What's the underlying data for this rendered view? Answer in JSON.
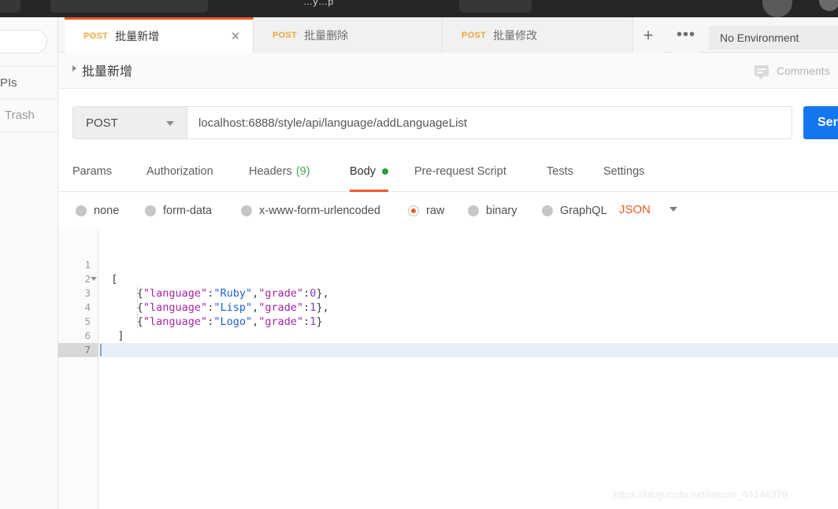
{
  "topbar": {
    "partial_text": "…y…p",
    "avatar_initials": ""
  },
  "sidebar": {
    "items": [
      {
        "label": "APIs",
        "name": "sidebar-item-apis"
      },
      {
        "label": "Trash",
        "name": "sidebar-item-trash"
      }
    ]
  },
  "request_tabs": {
    "items": [
      {
        "method": "POST",
        "title": "批量新增",
        "active": true,
        "closable": true
      },
      {
        "method": "POST",
        "title": "批量删除",
        "active": false,
        "closable": false
      },
      {
        "method": "POST",
        "title": "批量修改",
        "active": false,
        "closable": false
      }
    ],
    "new_tab_icon": "+",
    "more_icon": "•••"
  },
  "environment": {
    "selected": "No Environment"
  },
  "breadcrumb": {
    "title": "批量新增"
  },
  "comments": {
    "label": "Comments"
  },
  "request": {
    "method": "POST",
    "url": "localhost:6888/style/api/language/addLanguageList",
    "send_label": "Send"
  },
  "sub_tabs": [
    {
      "label": "Params",
      "active": false
    },
    {
      "label": "Authorization",
      "active": false
    },
    {
      "label": "Headers",
      "active": false,
      "count": "(9)"
    },
    {
      "label": "Body",
      "active": true,
      "dot": true
    },
    {
      "label": "Pre-request Script",
      "active": false
    },
    {
      "label": "Tests",
      "active": false
    },
    {
      "label": "Settings",
      "active": false
    }
  ],
  "body_types": {
    "options": [
      {
        "label": "none",
        "selected": false
      },
      {
        "label": "form-data",
        "selected": false
      },
      {
        "label": "x-www-form-urlencoded",
        "selected": false
      },
      {
        "label": "raw",
        "selected": true
      },
      {
        "label": "binary",
        "selected": false
      },
      {
        "label": "GraphQL",
        "selected": false
      }
    ],
    "format": "JSON"
  },
  "editor": {
    "line_numbers": [
      "1",
      "2",
      "3",
      "4",
      "5",
      "6",
      "7"
    ],
    "active_line": 7,
    "fold_line": 2,
    "lines": [
      {
        "n": 1,
        "tokens": []
      },
      {
        "n": 2,
        "tokens": [
          {
            "t": "punct",
            "v": "  ["
          }
        ]
      },
      {
        "n": 3,
        "tokens": [
          {
            "t": "punct",
            "v": "      {"
          },
          {
            "t": "key",
            "v": "\"language\""
          },
          {
            "t": "punct",
            "v": ":"
          },
          {
            "t": "str",
            "v": "\"Ruby\""
          },
          {
            "t": "punct",
            "v": ","
          },
          {
            "t": "key",
            "v": "\"grade\""
          },
          {
            "t": "punct",
            "v": ":"
          },
          {
            "t": "num",
            "v": "0"
          },
          {
            "t": "punct",
            "v": "},"
          }
        ]
      },
      {
        "n": 4,
        "tokens": [
          {
            "t": "punct",
            "v": "      {"
          },
          {
            "t": "key",
            "v": "\"language\""
          },
          {
            "t": "punct",
            "v": ":"
          },
          {
            "t": "str",
            "v": "\"Lisp\""
          },
          {
            "t": "punct",
            "v": ","
          },
          {
            "t": "key",
            "v": "\"grade\""
          },
          {
            "t": "punct",
            "v": ":"
          },
          {
            "t": "num",
            "v": "1"
          },
          {
            "t": "punct",
            "v": "},"
          }
        ]
      },
      {
        "n": 5,
        "tokens": [
          {
            "t": "punct",
            "v": "      {"
          },
          {
            "t": "key",
            "v": "\"language\""
          },
          {
            "t": "punct",
            "v": ":"
          },
          {
            "t": "str",
            "v": "\"Logo\""
          },
          {
            "t": "punct",
            "v": ","
          },
          {
            "t": "key",
            "v": "\"grade\""
          },
          {
            "t": "punct",
            "v": ":"
          },
          {
            "t": "num",
            "v": "1"
          },
          {
            "t": "punct",
            "v": "}"
          }
        ]
      },
      {
        "n": 6,
        "tokens": [
          {
            "t": "punct",
            "v": "   ]"
          }
        ]
      },
      {
        "n": 7,
        "tokens": []
      }
    ]
  },
  "watermark": {
    "text": "https://blog.csdn.net/weixin_44146379"
  },
  "colors": {
    "accent_orange": "#ef5b25",
    "method_orange": "#f0a63c",
    "send_blue": "#1477f0",
    "green_dot": "#23a13f",
    "header_count_green": "#3aab4e",
    "json_key": "#a626a4",
    "json_string": "#2160d8",
    "json_number": "#7c3fbf",
    "active_line": "#e7eff9"
  }
}
